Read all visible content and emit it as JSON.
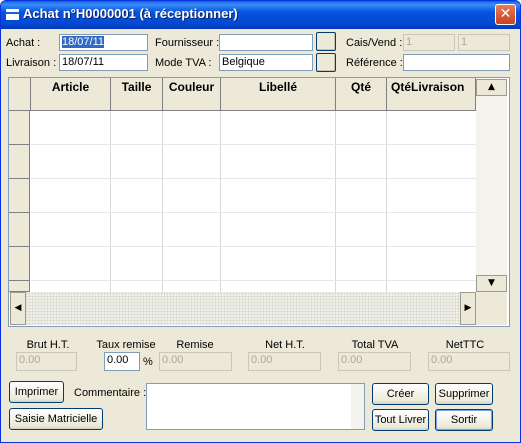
{
  "window": {
    "title": "Achat n°H0000001 (à réceptionner)",
    "close_symbol": "✕"
  },
  "header": {
    "achat_label": "Achat :",
    "achat_value": "18/07/11",
    "livraison_label": "Livraison :",
    "livraison_value": "18/07/11",
    "fournisseur_label": "Fournisseur :",
    "fournisseur_value": "",
    "mode_tva_label": "Mode TVA :",
    "mode_tva_value": "Belgique",
    "cais_vend_label": "Cais/Vend :",
    "cais_value": "1",
    "vend_value": "1",
    "reference_label": "Référence :",
    "reference_value": ""
  },
  "grid": {
    "columns": [
      "Article",
      "Taille",
      "Couleur",
      "Libellé",
      "Qté",
      "QtéLivraison"
    ],
    "rows": [],
    "scroll_up": "▲",
    "scroll_down": "▼",
    "scroll_left": "◀",
    "scroll_right": "▶"
  },
  "totals": {
    "brut_ht_label": "Brut H.T.",
    "brut_ht_value": "0.00",
    "taux_remise_label": "Taux remise",
    "taux_remise_value": "0.00",
    "percent_symbol": "%",
    "remise_label": "Remise",
    "remise_value": "0.00",
    "net_ht_label": "Net H.T.",
    "net_ht_value": "0.00",
    "total_tva_label": "Total TVA",
    "total_tva_value": "0.00",
    "net_ttc_label": "NetTTC",
    "net_ttc_value": "0.00"
  },
  "footer": {
    "imprimer_label": "Imprimer",
    "saisie_label": "Saisie Matricielle",
    "commentaire_label": "Commentaire :",
    "commentaire_value": "",
    "creer_label": "Créer",
    "supprimer_label": "Supprimer",
    "tout_livrer_label": "Tout Livrer",
    "sortir_label": "Sortir"
  }
}
